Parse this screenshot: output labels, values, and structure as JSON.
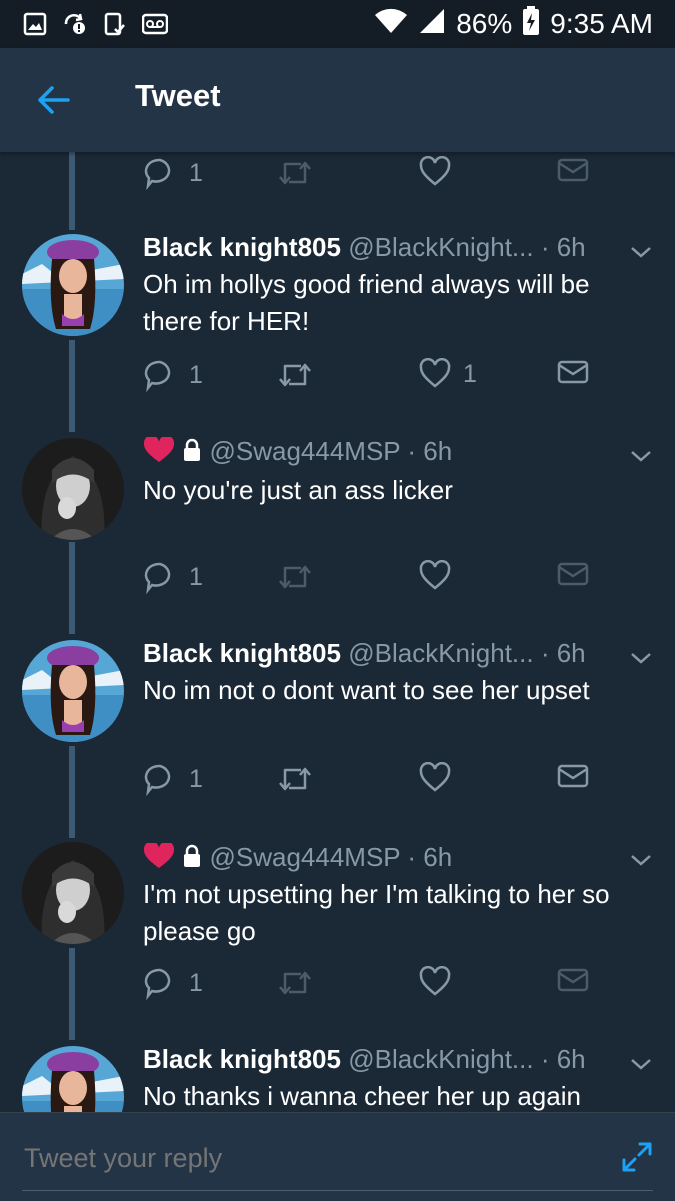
{
  "status_bar": {
    "battery": "86%",
    "time": "9:35 AM",
    "icons": [
      "image-icon",
      "sync-alert-icon",
      "device-check-icon",
      "voicemail-icon",
      "wifi-icon",
      "signal-icon",
      "battery-charging-icon"
    ]
  },
  "header": {
    "title": "Tweet",
    "back_icon": "back-arrow-icon"
  },
  "partial_actions": {
    "reply_count": "1"
  },
  "tweets": [
    {
      "name": "Black knight805",
      "handle": "@BlackKnight...",
      "time": "· 6h",
      "text": "Oh im hollys good friend always will be there for HER!",
      "reply_count": "1",
      "like_count": "1"
    },
    {
      "name": "",
      "handle": "@Swag444MSP",
      "time": "· 6h",
      "text": "No you're just an ass licker",
      "reply_count": "1",
      "like_count": ""
    },
    {
      "name": "Black knight805",
      "handle": "@BlackKnight...",
      "time": "· 6h",
      "text": "No im not o dont want to see her upset",
      "reply_count": "1",
      "like_count": ""
    },
    {
      "name": "",
      "handle": "@Swag444MSP",
      "time": "· 6h",
      "text": "I'm not upsetting her I'm talking to her so please go",
      "reply_count": "1",
      "like_count": ""
    },
    {
      "name": "Black knight805",
      "handle": "@BlackKnight...",
      "time": "· 6h",
      "text": "No thanks i wanna cheer her up again",
      "reply_count": "",
      "like_count": ""
    }
  ],
  "reply_bar": {
    "placeholder": "Tweet your reply"
  },
  "colors": {
    "background": "#1b2836",
    "header": "#243447",
    "accent": "#1da1f2",
    "muted": "#8899a6",
    "heart": "#e0245e"
  }
}
